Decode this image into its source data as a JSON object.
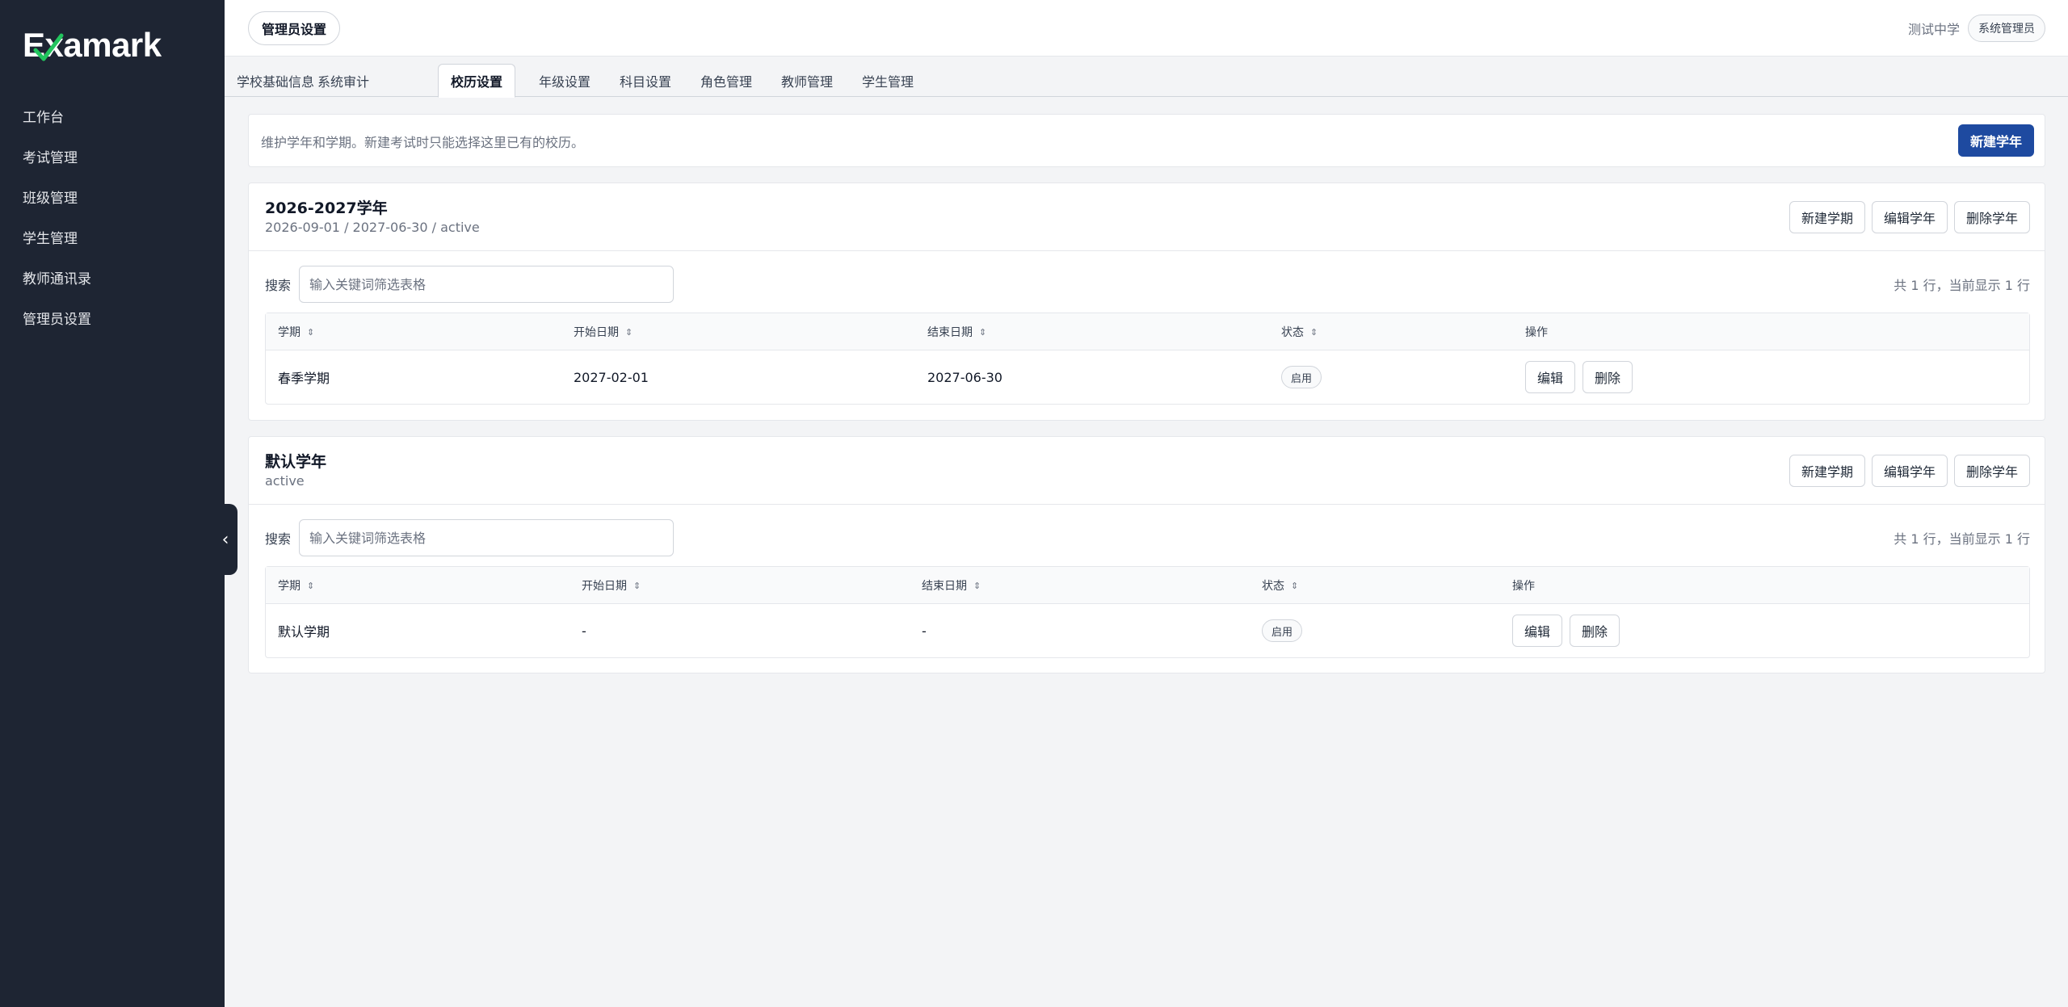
{
  "brand": {
    "name": "Examark"
  },
  "sidebar": {
    "items": [
      {
        "label": "工作台"
      },
      {
        "label": "考试管理"
      },
      {
        "label": "班级管理"
      },
      {
        "label": "学生管理"
      },
      {
        "label": "教师通讯录"
      },
      {
        "label": "管理员设置"
      }
    ],
    "collapse_glyph": "‹"
  },
  "header": {
    "page_title": "管理员设置",
    "school": "测试中学",
    "role": "系统管理员"
  },
  "tabs": [
    {
      "label": "学校基础信息",
      "active": false
    },
    {
      "label": "系统审计",
      "active": false
    },
    {
      "label": "校历设置",
      "active": true
    },
    {
      "label": "年级设置",
      "active": false
    },
    {
      "label": "科目设置",
      "active": false
    },
    {
      "label": "角色管理",
      "active": false
    },
    {
      "label": "教师管理",
      "active": false
    },
    {
      "label": "学生管理",
      "active": false
    }
  ],
  "info": {
    "description": "维护学年和学期。新建考试时只能选择这里已有的校历。",
    "new_year_button": "新建学年"
  },
  "colors": {
    "sidebar_bg": "#1e2533",
    "primary": "#1e4aa0",
    "logo_check": "#22c55e"
  },
  "years": [
    {
      "title": "2026-2027学年",
      "subtitle": "2026-09-01 / 2027-06-30 / active",
      "actions": {
        "new_term": "新建学期",
        "edit_year": "编辑学年",
        "delete_year": "删除学年"
      },
      "search_label": "搜索",
      "search_placeholder": "输入关键词筛选表格",
      "search_value": "",
      "count_text": "共 1 行，当前显示 1 行",
      "columns": {
        "term": "学期",
        "start": "开始日期",
        "end": "结束日期",
        "status": "状态",
        "ops": "操作"
      },
      "rows": [
        {
          "term": "春季学期",
          "start": "2027-02-01",
          "end": "2027-06-30",
          "status": "启用",
          "edit": "编辑",
          "delete": "删除"
        }
      ]
    },
    {
      "title": "默认学年",
      "subtitle": "active",
      "actions": {
        "new_term": "新建学期",
        "edit_year": "编辑学年",
        "delete_year": "删除学年"
      },
      "search_label": "搜索",
      "search_placeholder": "输入关键词筛选表格",
      "search_value": "",
      "count_text": "共 1 行，当前显示 1 行",
      "columns": {
        "term": "学期",
        "start": "开始日期",
        "end": "结束日期",
        "status": "状态",
        "ops": "操作"
      },
      "rows": [
        {
          "term": "默认学期",
          "start": "-",
          "end": "-",
          "status": "启用",
          "edit": "编辑",
          "delete": "删除"
        }
      ]
    }
  ]
}
